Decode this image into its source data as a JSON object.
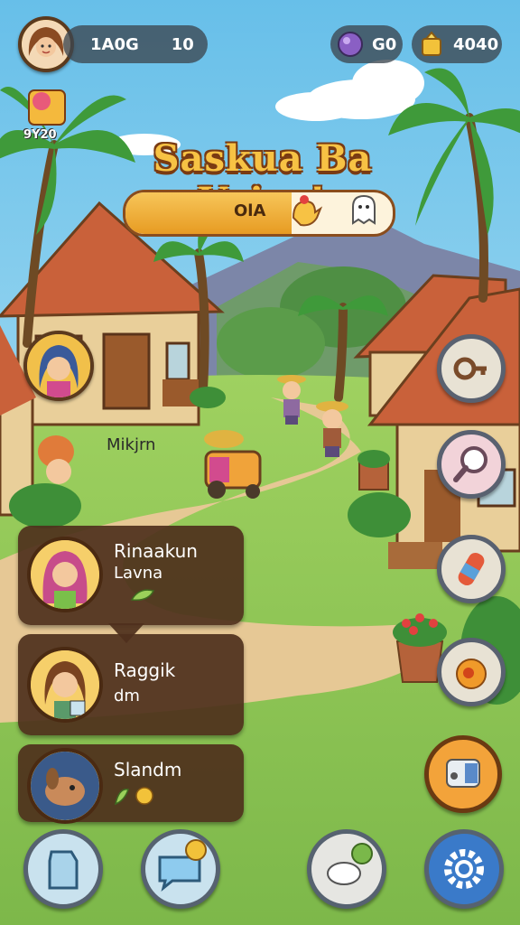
{
  "hud": {
    "player_label": "1A0G",
    "player_value": "10",
    "gems": "G0",
    "gold": "4040",
    "event_label": "9Y20"
  },
  "banner": {
    "title": "Saskua Ba Voies!",
    "progress_text": "OlA",
    "progress": 0.62
  },
  "scene": {
    "npc_label": "Mikjrn"
  },
  "cards": [
    {
      "name": "Rinaakun",
      "sub": "Lavna"
    },
    {
      "name": "Raggik",
      "sub": "dm"
    },
    {
      "name": "Slandm",
      "sub": ""
    }
  ],
  "side_buttons": [
    "key-icon",
    "magnify-icon",
    "potion-icon",
    "fruit-icon",
    "machine-icon"
  ],
  "bottom_buttons": [
    "milk-icon",
    "chat-icon",
    "sheep-icon",
    "settings-icon"
  ],
  "colors": {
    "sky": "#8fd0ee",
    "grass": "#8cc456",
    "path": "#e3c38f",
    "roof": "#c75d36",
    "hud": "#3c4650"
  }
}
